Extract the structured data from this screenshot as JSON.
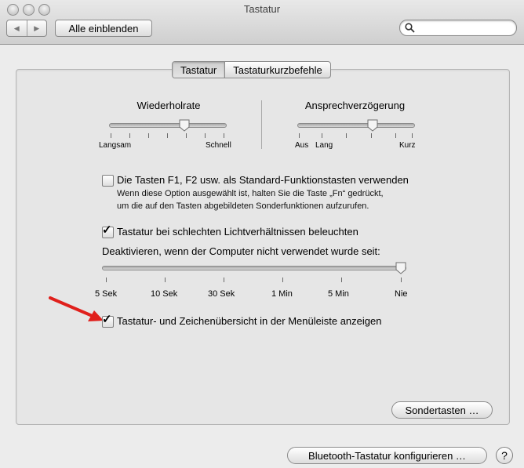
{
  "window": {
    "title": "Tastatur"
  },
  "toolbar": {
    "back_icon": "◀",
    "forward_icon": "▶",
    "show_all_label": "Alle einblenden",
    "search_placeholder": "",
    "search_value": ""
  },
  "tabs": [
    {
      "label": "Tastatur",
      "active": true
    },
    {
      "label": "Tastaturkurzbefehle",
      "active": false
    }
  ],
  "key_repeat": {
    "title": "Wiederholrate",
    "min_label": "Langsam",
    "max_label": "Schnell",
    "value_fraction": 0.65
  },
  "delay_until_repeat": {
    "title": "Ansprechverzögerung",
    "off_label": "Aus",
    "min_label": "Lang",
    "max_label": "Kurz",
    "value_fraction": 0.65
  },
  "fn_keys": {
    "checked": false,
    "label": "Die Tasten F1, F2 usw. als Standard-Funktionstasten verwenden",
    "hint_line1": "Wenn diese Option ausgewählt ist, halten Sie die Taste „Fn“ gedrückt,",
    "hint_line2": "um die auf den Tasten abgebildeten Sonderfunktionen aufzurufen."
  },
  "illumination": {
    "checked": true,
    "label": "Tastatur bei schlechten Lichtverhältnissen beleuchten",
    "deactivate_label": "Deaktivieren, wenn der Computer nicht verwendet wurde seit:",
    "ticks": [
      "5 Sek",
      "10 Sek",
      "30 Sek",
      "1 Min",
      "5 Min",
      "Nie"
    ],
    "selected": "Nie"
  },
  "menubar_viewer": {
    "checked": true,
    "label": "Tastatur- und Zeichenübersicht in der Menüleiste anzeigen"
  },
  "buttons": {
    "modifier_keys": "Sondertasten …",
    "bluetooth": "Bluetooth-Tastatur konfigurieren …",
    "help": "?"
  },
  "colors": {
    "arrow": "#e0201c"
  }
}
